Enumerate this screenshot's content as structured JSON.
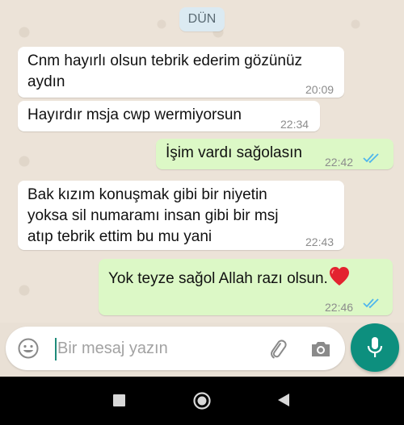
{
  "chat": {
    "date_divider": "DÜN",
    "messages": [
      {
        "direction": "in",
        "line1": "Cnm hayırlı olsun tebrik ederim gözünüz",
        "line2": "aydın",
        "time": "20:09"
      },
      {
        "direction": "in",
        "line1": "Hayırdır msja cwp wermiyorsun",
        "time": "22:34"
      },
      {
        "direction": "out",
        "line1": "İşim vardı sağolasın",
        "time": "22:42",
        "status": "read"
      },
      {
        "direction": "in",
        "line1": "Bak kızım konuşmak gibi bir niyetin",
        "line2": "yoksa sil numaramı insan gibi bir msj",
        "line3": "atıp tebrik ettim bu mu yani",
        "time": "22:43"
      },
      {
        "direction": "out",
        "line1": "Yok teyze sağol Allah razı olsun.",
        "emoji": "heart",
        "time": "22:46",
        "status": "read"
      }
    ]
  },
  "composer": {
    "placeholder": "Bir mesaj yazın",
    "icons": [
      "emoji-icon",
      "attach-icon",
      "camera-icon",
      "mic-icon"
    ]
  },
  "colors": {
    "incoming_bubble": "#ffffff",
    "outgoing_bubble": "#dcf8c6",
    "accent": "#0d8f7e",
    "read_ticks": "#4fb6ec"
  },
  "system_nav": [
    "recent-apps-icon",
    "home-icon",
    "back-icon"
  ]
}
